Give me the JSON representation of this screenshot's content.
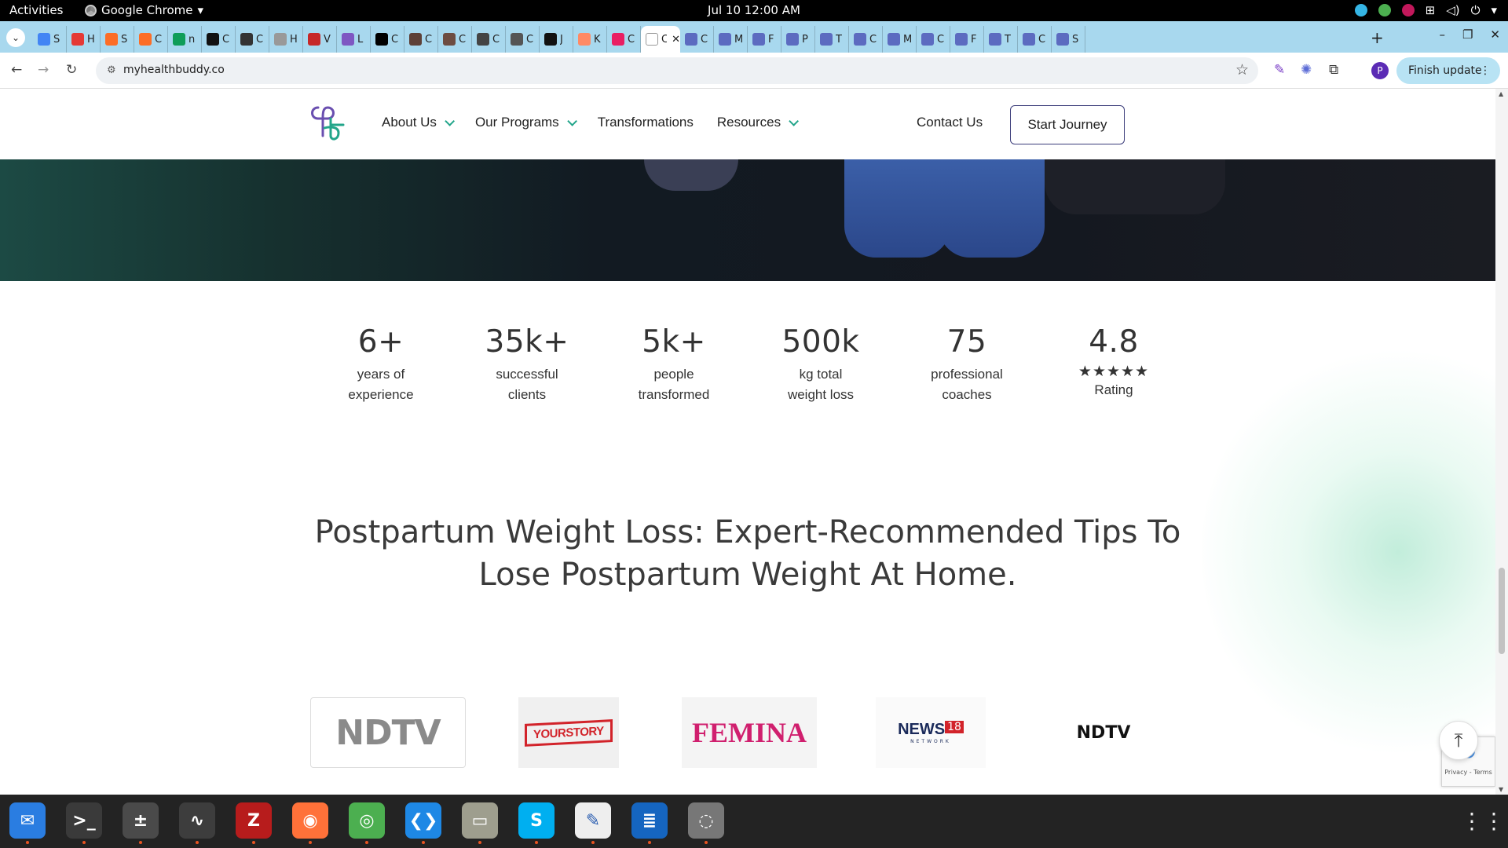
{
  "system": {
    "activities": "Activities",
    "app_menu": "Google Chrome",
    "clock": "Jul 10  12:00 AM"
  },
  "browser": {
    "tabs": [
      {
        "letter": "S",
        "color": "#4285f4"
      },
      {
        "letter": "H",
        "color": "#e53935"
      },
      {
        "letter": "S",
        "color": "#fc6d26"
      },
      {
        "letter": "C",
        "color": "#fc6d26"
      },
      {
        "letter": "n",
        "color": "#0f9d58"
      },
      {
        "letter": "C",
        "color": "#111111"
      },
      {
        "letter": "C",
        "color": "#333333"
      },
      {
        "letter": "H",
        "color": "#999999"
      },
      {
        "letter": "V",
        "color": "#c62828"
      },
      {
        "letter": "L",
        "color": "#7e57c2"
      },
      {
        "letter": "C",
        "color": "#000000"
      },
      {
        "letter": "C",
        "color": "#5d4037"
      },
      {
        "letter": "C",
        "color": "#6d4c41"
      },
      {
        "letter": "C",
        "color": "#444444"
      },
      {
        "letter": "C",
        "color": "#555555"
      },
      {
        "letter": "J",
        "color": "#111111"
      },
      {
        "letter": "K",
        "color": "#ff8a65"
      },
      {
        "letter": "C",
        "color": "#e91e63"
      },
      {
        "letter": "C",
        "color": "#ffffff",
        "active": true
      },
      {
        "letter": "C",
        "color": "#5c6bc0"
      },
      {
        "letter": "M",
        "color": "#5c6bc0"
      },
      {
        "letter": "F",
        "color": "#5c6bc0"
      },
      {
        "letter": "P",
        "color": "#5c6bc0"
      },
      {
        "letter": "T",
        "color": "#5c6bc0"
      },
      {
        "letter": "C",
        "color": "#5c6bc0"
      },
      {
        "letter": "M",
        "color": "#5c6bc0"
      },
      {
        "letter": "C",
        "color": "#5c6bc0"
      },
      {
        "letter": "F",
        "color": "#5c6bc0"
      },
      {
        "letter": "T",
        "color": "#5c6bc0"
      },
      {
        "letter": "C",
        "color": "#5c6bc0"
      },
      {
        "letter": "S",
        "color": "#5c6bc0"
      }
    ],
    "url": "myhealthbuddy.co",
    "finish_update": "Finish update",
    "profile_initial": "P"
  },
  "site": {
    "nav": {
      "about": "About Us",
      "programs": "Our Programs",
      "transformations": "Transformations",
      "resources": "Resources",
      "contact": "Contact Us",
      "cta": "Start Journey"
    },
    "stats": [
      {
        "value": "6+",
        "label": "years of\nexperience"
      },
      {
        "value": "35k+",
        "label": "successful\nclients"
      },
      {
        "value": "5k+",
        "label": "people\ntransformed"
      },
      {
        "value": "500k",
        "label": "kg total\nweight loss"
      },
      {
        "value": "75",
        "label": "professional\ncoaches"
      },
      {
        "value": "4.8",
        "label": "Rating",
        "stars": "★★★★★"
      }
    ],
    "headline": "Postpartum Weight Loss: Expert-Recommended Tips To Lose Postpartum Weight At Home.",
    "press": [
      "NDTV",
      "YOURSTORY",
      "FEMINA",
      "NEWS",
      "NDTV"
    ],
    "press_extra": {
      "news_num": "18",
      "news_sub": "NETWORK"
    },
    "recaptcha": "Privacy - Terms"
  },
  "dock": [
    {
      "name": "thunderbird",
      "color": "#2a7de1",
      "glyph": "✉"
    },
    {
      "name": "terminal",
      "color": "#3a3a3a",
      "glyph": ">_"
    },
    {
      "name": "calculator",
      "color": "#4a4a4a",
      "glyph": "±"
    },
    {
      "name": "system-monitor",
      "color": "#3d3d3d",
      "glyph": "∿"
    },
    {
      "name": "filezilla",
      "color": "#b71c1c",
      "glyph": "Z"
    },
    {
      "name": "firefox",
      "color": "#ff7139",
      "glyph": "◉"
    },
    {
      "name": "chrome",
      "color": "#4caf50",
      "glyph": "◎"
    },
    {
      "name": "vscode",
      "color": "#1e88e5",
      "glyph": "❮❯"
    },
    {
      "name": "files",
      "color": "#9e9e8e",
      "glyph": "▭"
    },
    {
      "name": "skype",
      "color": "#00aff0",
      "glyph": "S"
    },
    {
      "name": "text-editor",
      "color": "#eeeeee",
      "glyph": "✎"
    },
    {
      "name": "document-viewer",
      "color": "#1565c0",
      "glyph": "≣"
    },
    {
      "name": "disks",
      "color": "#777777",
      "glyph": "◌"
    }
  ],
  "colors": {
    "accent_teal": "#22a58a",
    "cta_border": "#3b3c7a",
    "headline_text": "#3a3a3a",
    "tab_strip": "#a8d8ee"
  }
}
